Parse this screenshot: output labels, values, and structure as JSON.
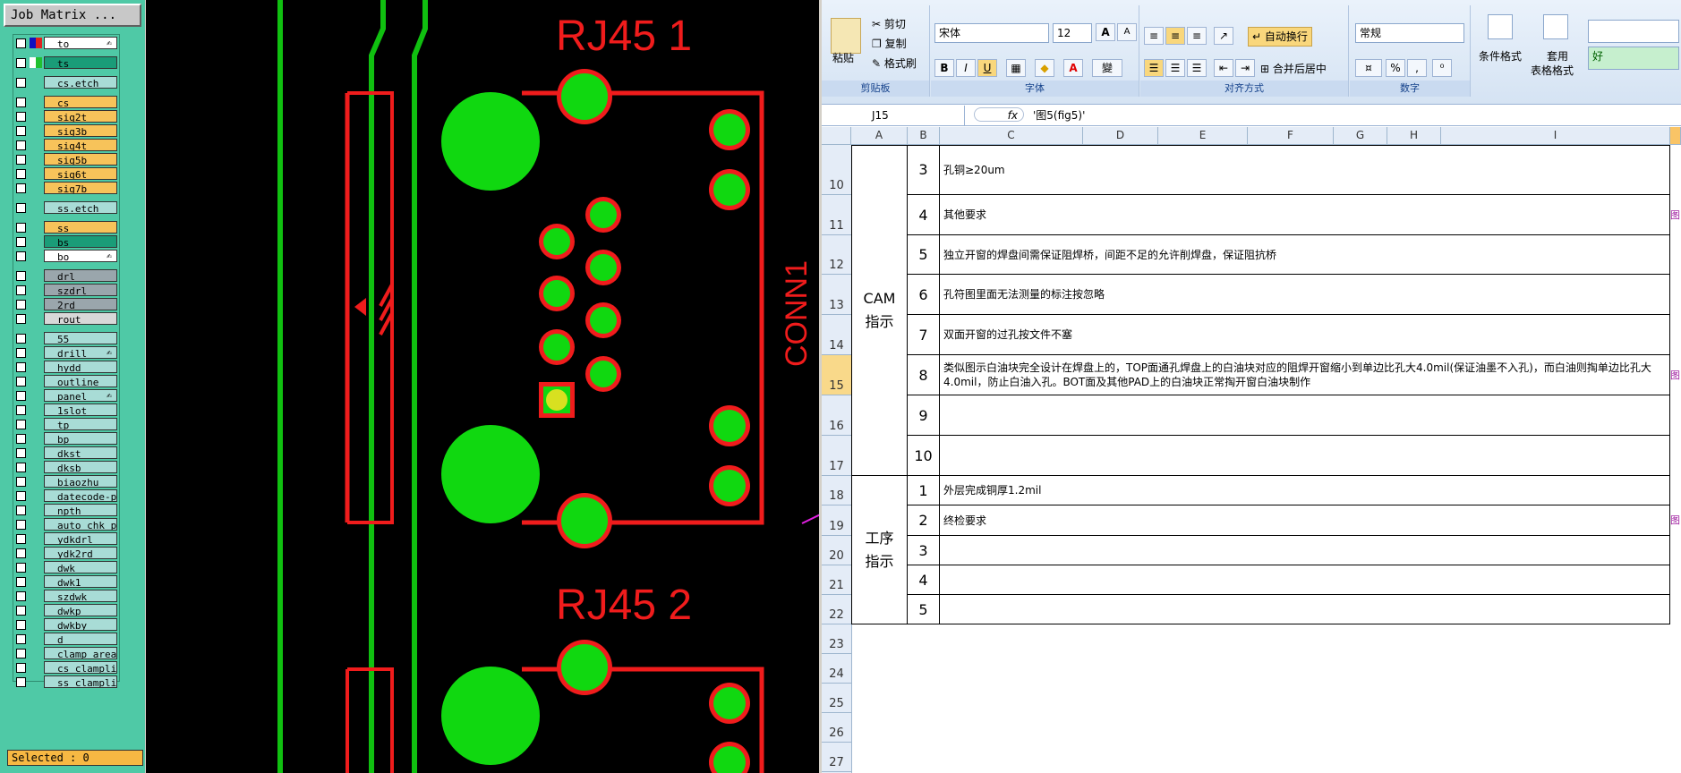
{
  "job_matrix": {
    "title": "Job Matrix ...",
    "selected": "Selected : 0",
    "layers": [
      {
        "name": "to",
        "color": "#ffffff",
        "sw1": "#1010c0",
        "sw2": "#e02020",
        "icon": "✍"
      },
      {
        "name": "ts",
        "color": "#1a9c78",
        "sw1": "#ffffff",
        "sw2": "#20c030",
        "icon": ""
      },
      {
        "name": "cs.etch",
        "color": "#a8dcd6",
        "sw1": "",
        "sw2": "",
        "icon": ""
      },
      {
        "name": "cs",
        "color": "#f7c35a",
        "sw1": "",
        "sw2": "",
        "icon": ""
      },
      {
        "name": "sig2t",
        "color": "#f7c35a",
        "sw1": "",
        "sw2": "",
        "icon": ""
      },
      {
        "name": "sig3b",
        "color": "#f7c35a",
        "sw1": "",
        "sw2": "",
        "icon": ""
      },
      {
        "name": "sig4t",
        "color": "#f7c35a",
        "sw1": "",
        "sw2": "",
        "icon": ""
      },
      {
        "name": "sig5b",
        "color": "#f7c35a",
        "sw1": "",
        "sw2": "",
        "icon": ""
      },
      {
        "name": "sig6t",
        "color": "#f7c35a",
        "sw1": "",
        "sw2": "",
        "icon": ""
      },
      {
        "name": "sig7b",
        "color": "#f7c35a",
        "sw1": "",
        "sw2": "",
        "icon": ""
      },
      {
        "name": "ss.etch",
        "color": "#a8dcd6",
        "sw1": "",
        "sw2": "",
        "icon": ""
      },
      {
        "name": "ss",
        "color": "#f7c35a",
        "sw1": "",
        "sw2": "",
        "icon": ""
      },
      {
        "name": "bs",
        "color": "#1a9c78",
        "sw1": "",
        "sw2": "",
        "icon": ""
      },
      {
        "name": "bo",
        "color": "#ffffff",
        "sw1": "",
        "sw2": "",
        "icon": "✍"
      },
      {
        "name": "drl",
        "color": "#9aa6ac",
        "sw1": "",
        "sw2": "",
        "icon": ""
      },
      {
        "name": "szdrl",
        "color": "#9aa6ac",
        "sw1": "",
        "sw2": "",
        "icon": ""
      },
      {
        "name": "2rd",
        "color": "#9aa6ac",
        "sw1": "",
        "sw2": "",
        "icon": ""
      },
      {
        "name": "rout",
        "color": "#d8d8d8",
        "sw1": "",
        "sw2": "",
        "icon": ""
      },
      {
        "name": "55",
        "color": "#a8dcd6",
        "sw1": "",
        "sw2": "",
        "icon": ""
      },
      {
        "name": "drill",
        "color": "#a8dcd6",
        "sw1": "",
        "sw2": "",
        "icon": "✍"
      },
      {
        "name": "hydd",
        "color": "#a8dcd6",
        "sw1": "",
        "sw2": "",
        "icon": ""
      },
      {
        "name": "outline",
        "color": "#a8dcd6",
        "sw1": "",
        "sw2": "",
        "icon": ""
      },
      {
        "name": "panel",
        "color": "#a8dcd6",
        "sw1": "",
        "sw2": "",
        "icon": "✍"
      },
      {
        "name": "1slot",
        "color": "#a8dcd6",
        "sw1": "",
        "sw2": "",
        "icon": ""
      },
      {
        "name": "tp",
        "color": "#a8dcd6",
        "sw1": "",
        "sw2": "",
        "icon": ""
      },
      {
        "name": "bp",
        "color": "#a8dcd6",
        "sw1": "",
        "sw2": "",
        "icon": ""
      },
      {
        "name": "dkst",
        "color": "#a8dcd6",
        "sw1": "",
        "sw2": "",
        "icon": ""
      },
      {
        "name": "dksb",
        "color": "#a8dcd6",
        "sw1": "",
        "sw2": "",
        "icon": ""
      },
      {
        "name": "biaozhu",
        "color": "#a8dcd6",
        "sw1": "",
        "sw2": "",
        "icon": ""
      },
      {
        "name": "datecode-pbe",
        "color": "#a8dcd6",
        "sw1": "",
        "sw2": "",
        "icon": ""
      },
      {
        "name": "npth",
        "color": "#a8dcd6",
        "sw1": "",
        "sw2": "",
        "icon": ""
      },
      {
        "name": "auto_chk_pn",
        "color": "#a8dcd6",
        "sw1": "",
        "sw2": "",
        "icon": ""
      },
      {
        "name": "ydkdrl",
        "color": "#a8dcd6",
        "sw1": "",
        "sw2": "",
        "icon": ""
      },
      {
        "name": "ydk2rd",
        "color": "#a8dcd6",
        "sw1": "",
        "sw2": "",
        "icon": ""
      },
      {
        "name": "dwk",
        "color": "#a8dcd6",
        "sw1": "",
        "sw2": "",
        "icon": ""
      },
      {
        "name": "dwk1",
        "color": "#a8dcd6",
        "sw1": "",
        "sw2": "",
        "icon": ""
      },
      {
        "name": "szdwk",
        "color": "#a8dcd6",
        "sw1": "",
        "sw2": "",
        "icon": ""
      },
      {
        "name": "dwkp",
        "color": "#a8dcd6",
        "sw1": "",
        "sw2": "",
        "icon": ""
      },
      {
        "name": "dwkby",
        "color": "#a8dcd6",
        "sw1": "",
        "sw2": "",
        "icon": ""
      },
      {
        "name": "d",
        "color": "#a8dcd6",
        "sw1": "",
        "sw2": "",
        "icon": ""
      },
      {
        "name": "clamp_area",
        "color": "#a8dcd6",
        "sw1": "",
        "sw2": "",
        "icon": ""
      },
      {
        "name": "cs_clampline",
        "color": "#a8dcd6",
        "sw1": "",
        "sw2": "",
        "icon": ""
      },
      {
        "name": "ss_clampline",
        "color": "#a8dcd6",
        "sw1": "",
        "sw2": "",
        "icon": ""
      }
    ]
  },
  "pcb": {
    "label_rj45_1": "RJ45 1",
    "label_rj45_2": "RJ45 2",
    "label_conn": "CONN1",
    "colors": {
      "copper": "#10d810",
      "silk": "#f01c1c",
      "trace": "#10c010",
      "bg": "#000000"
    }
  },
  "excel": {
    "ribbon": {
      "clipboard": {
        "paste": "粘贴",
        "cut": "剪切",
        "copy": "复制",
        "format_painter": "格式刷",
        "label": "剪贴板"
      },
      "font": {
        "name": "宋体",
        "size": "12",
        "label": "字体",
        "bold": "B",
        "italic": "I",
        "underline": "U",
        "grow": "A",
        "shrink": "A",
        "color_a": "A",
        "wen": "變"
      },
      "alignment": {
        "wrap": "自动换行",
        "merge": "合并后居中",
        "label": "对齐方式"
      },
      "number": {
        "format": "常规",
        "percent": "%",
        "comma": ",",
        "label": "数字"
      },
      "styles": {
        "cond_format": "条件格式",
        "table_format_1": "套用",
        "table_format_2": "表格格式",
        "good": "好"
      }
    },
    "formula_bar": {
      "name_box": "J15",
      "fx": "fx",
      "content": "'图5(fig5)'"
    },
    "columns": [
      "A",
      "B",
      "C",
      "D",
      "E",
      "F",
      "G",
      "H",
      "I"
    ],
    "rows": [
      {
        "num": "10",
        "b": "3",
        "c": "孔铜≥20um"
      },
      {
        "num": "11",
        "b": "4",
        "c": "其他要求"
      },
      {
        "num": "12",
        "b": "5",
        "c": "独立开窗的焊盘间需保证阻焊桥，间距不足的允许削焊盘，保证阻抗桥"
      },
      {
        "num": "13",
        "b": "6",
        "c": "孔符图里面无法测量的标注按忽略"
      },
      {
        "num": "14",
        "b": "7",
        "c": "双面开窗的过孔按文件不塞"
      },
      {
        "num": "15",
        "b": "8",
        "c": "类似图示白油块完全设计在焊盘上的，TOP面通孔焊盘上的白油块对应的阻焊开窗缩小到单边比孔大4.0mil(保证油墨不入孔)，而白油则掏单边比孔大4.0mil，防止白油入孔。BOT面及其他PAD上的白油块正常掏开窗白油块制作"
      },
      {
        "num": "16",
        "b": "9",
        "c": ""
      },
      {
        "num": "17",
        "b": "10",
        "c": ""
      },
      {
        "num": "18",
        "b": "1",
        "c": "外层完成铜厚1.2mil"
      },
      {
        "num": "19",
        "b": "2",
        "c": "终检要求"
      },
      {
        "num": "20",
        "b": "3",
        "c": ""
      },
      {
        "num": "21",
        "b": "4",
        "c": ""
      },
      {
        "num": "22",
        "b": "5",
        "c": ""
      },
      {
        "num": "23",
        "b": "",
        "c": ""
      },
      {
        "num": "24",
        "b": "",
        "c": ""
      },
      {
        "num": "25",
        "b": "",
        "c": ""
      },
      {
        "num": "26",
        "b": "",
        "c": ""
      },
      {
        "num": "27",
        "b": "",
        "c": ""
      }
    ],
    "groups": {
      "cam_1": "CAM",
      "cam_2": "指示",
      "proc_1": "工序",
      "proc_2": "指示"
    },
    "side_marker": "图"
  }
}
